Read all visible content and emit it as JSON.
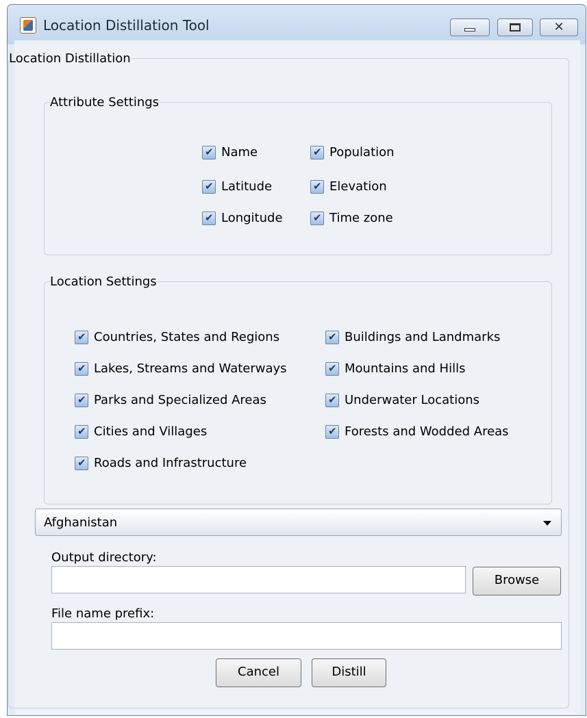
{
  "window": {
    "title": "Location Distillation Tool",
    "close_glyph": "✕"
  },
  "main_group": {
    "title": "Location Distillation"
  },
  "attribute_settings": {
    "title": "Attribute Settings",
    "items": [
      {
        "label": "Name",
        "checked": true
      },
      {
        "label": "Latitude",
        "checked": true
      },
      {
        "label": "Longitude",
        "checked": true
      },
      {
        "label": "Population",
        "checked": true
      },
      {
        "label": "Elevation",
        "checked": true
      },
      {
        "label": "Time zone",
        "checked": true
      }
    ]
  },
  "location_settings": {
    "title": "Location Settings",
    "items": [
      {
        "label": "Countries, States and Regions",
        "checked": true
      },
      {
        "label": "Lakes, Streams and Waterways",
        "checked": true
      },
      {
        "label": "Parks and Specialized Areas",
        "checked": true
      },
      {
        "label": "Cities and Villages",
        "checked": true
      },
      {
        "label": "Roads and Infrastructure",
        "checked": true
      },
      {
        "label": "Buildings and Landmarks",
        "checked": true
      },
      {
        "label": "Mountains and Hills",
        "checked": true
      },
      {
        "label": "Underwater Locations",
        "checked": true
      },
      {
        "label": "Forests and Wodded Areas",
        "checked": true
      }
    ]
  },
  "country_select": {
    "selected": "Afghanistan"
  },
  "output_directory": {
    "label": "Output directory:",
    "value": ""
  },
  "browse_button": {
    "label": "Browse"
  },
  "file_prefix": {
    "label": "File name prefix:",
    "value": ""
  },
  "cancel_button": {
    "label": "Cancel"
  },
  "distill_button": {
    "label": "Distill"
  }
}
